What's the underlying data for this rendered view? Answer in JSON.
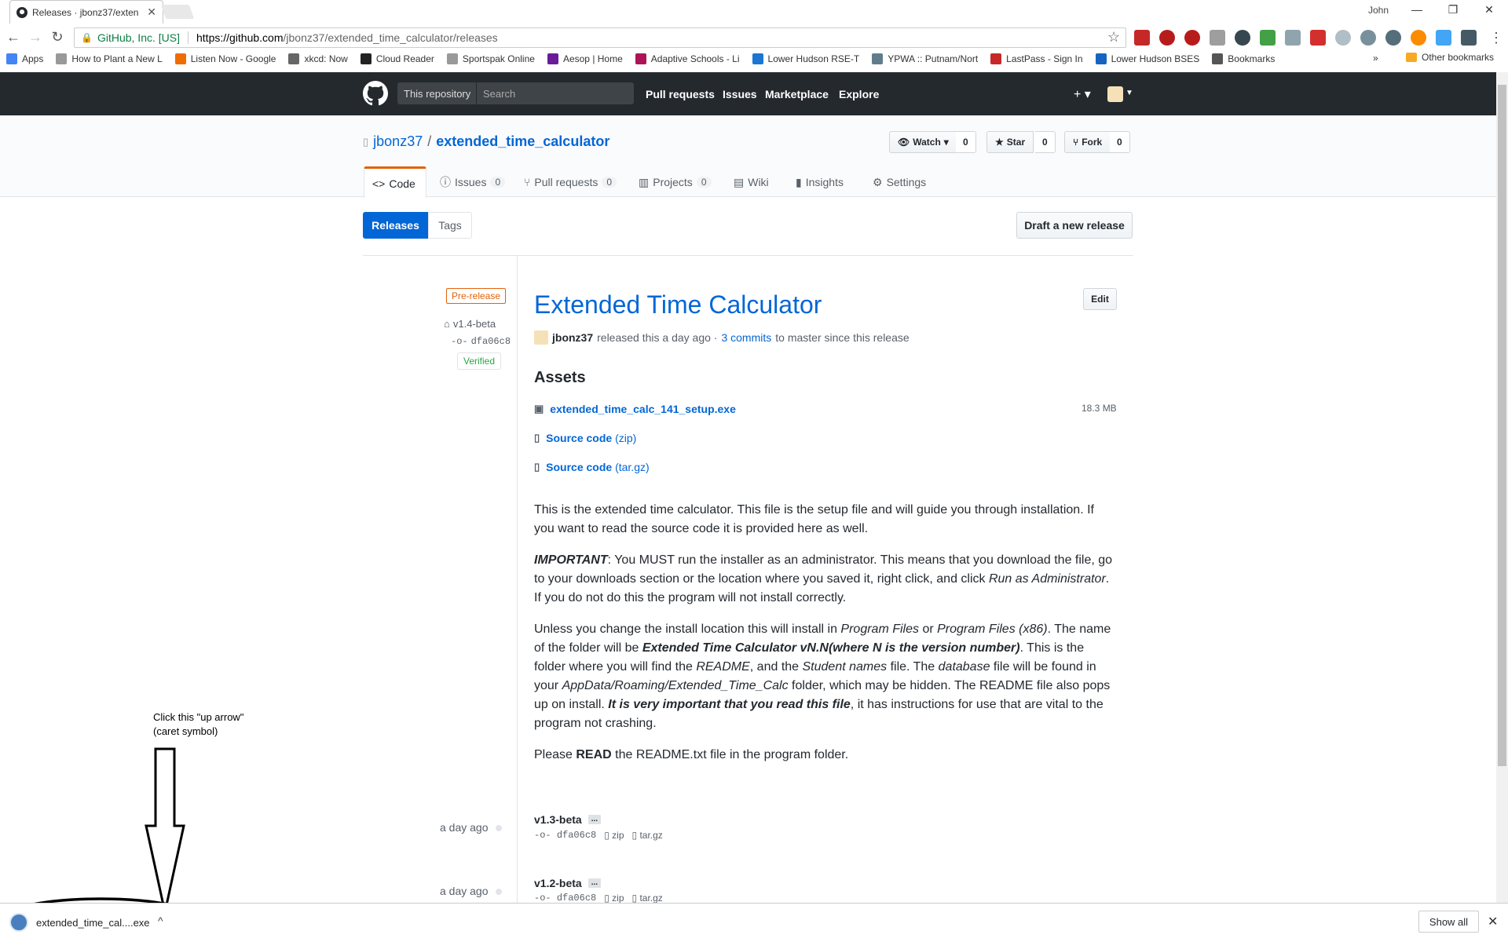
{
  "browser": {
    "tab_title": "Releases · jbonz37/exten",
    "user_label": "John",
    "url_secure_label": "GitHub, Inc. [US]",
    "url_host": "https://github.com",
    "url_path": "/jbonz37/extended_time_calculator/releases"
  },
  "bookmarks": [
    {
      "label": "Apps",
      "icon": "apps-grid-icon",
      "color": "#4285f4"
    },
    {
      "label": "How to Plant a New L",
      "icon": "page-icon",
      "color": "#999999"
    },
    {
      "label": "Listen Now - Google",
      "icon": "music-icon",
      "color": "#ef6c00"
    },
    {
      "label": "xkcd: Now",
      "icon": "xkcd-icon",
      "color": "#666666"
    },
    {
      "label": "Cloud Reader",
      "icon": "kindle-icon",
      "color": "#222222"
    },
    {
      "label": "Sportspak Online",
      "icon": "page-icon",
      "color": "#999999"
    },
    {
      "label": "Aesop | Home",
      "icon": "aesop-icon",
      "color": "#6a1b9a"
    },
    {
      "label": "Adaptive Schools - Li",
      "icon": "page-icon",
      "color": "#ad1457"
    },
    {
      "label": "Lower Hudson RSE-T",
      "icon": "vs-icon",
      "color": "#1976d2"
    },
    {
      "label": "YPWA :: Putnam/Nort",
      "icon": "ypwa-icon",
      "color": "#607d8b"
    },
    {
      "label": "LastPass - Sign In",
      "icon": "lastpass-icon",
      "color": "#c62828"
    },
    {
      "label": "Lower Hudson BSES",
      "icon": "frame-icon",
      "color": "#1565c0"
    },
    {
      "label": "Bookmarks",
      "icon": "star-icon",
      "color": "#555555"
    }
  ],
  "other_bookmarks": "Other bookmarks",
  "github": {
    "scope_label": "This repository",
    "search_placeholder": "Search",
    "nav": [
      "Pull requests",
      "Issues",
      "Marketplace",
      "Explore"
    ]
  },
  "repo": {
    "owner": "jbonz37",
    "separator": "/",
    "name": "extended_time_calculator",
    "watch_label": "Watch",
    "watch_count": "0",
    "star_label": "Star",
    "star_count": "0",
    "fork_label": "Fork",
    "fork_count": "0",
    "tabs": [
      {
        "label": "Code",
        "count": ""
      },
      {
        "label": "Issues",
        "count": "0"
      },
      {
        "label": "Pull requests",
        "count": "0"
      },
      {
        "label": "Projects",
        "count": "0"
      },
      {
        "label": "Wiki",
        "count": ""
      },
      {
        "label": "Insights",
        "count": ""
      },
      {
        "label": "Settings",
        "count": ""
      }
    ]
  },
  "subnav": {
    "releases": "Releases",
    "tags": "Tags",
    "draft": "Draft a new release"
  },
  "release": {
    "prerelease_label": "Pre-release",
    "tag": "v1.4-beta",
    "commit": "dfa06c8",
    "verified": "Verified",
    "title": "Extended Time Calculator",
    "edit_label": "Edit",
    "author": "jbonz37",
    "released_text": "released this a day ago ·",
    "commits_link": "3 commits",
    "commits_suffix": "to master since this release",
    "assets_heading": "Assets",
    "assets": [
      {
        "name": "extended_time_calc_141_setup.exe",
        "sub": "",
        "size": "18.3 MB"
      },
      {
        "name": "Source code",
        "sub": "(zip)",
        "size": ""
      },
      {
        "name": "Source code",
        "sub": "(tar.gz)",
        "size": ""
      }
    ],
    "p1": "This is the extended time calculator. This file is the setup file and will guide you through installation. If you want to read the source code it is provided here as well.",
    "p2_lead": "IMPORTANT",
    "p2_a": ": You MUST run the installer as an administrator. This means that you download the file, go to your downloads section or the location where you saved it, right click, and click ",
    "p2_em": "Run as Administrator",
    "p2_b": ". If you do not do this the program will not install correctly.",
    "p3_a": "Unless you change the install location this will install in ",
    "p3_em1": "Program Files",
    "p3_b": " or ",
    "p3_em2": "Program Files (x86)",
    "p3_c": ". The name of the folder will be ",
    "p3_strong": "Extended Time Calculator vN.N(where N is the version number)",
    "p3_d": ". This is the folder where you will find the ",
    "p3_em3": "README",
    "p3_e": ", and the ",
    "p3_em4": "Student names",
    "p3_f": " file. The ",
    "p3_em5": "database",
    "p3_g": " file will be found in your ",
    "p3_em6": "AppData/Roaming/Extended_Time_Calc",
    "p3_h": " folder, which may be hidden. The README file also pops up on install. ",
    "p3_strong2": "It is very important that you read this file",
    "p3_i": ", it has instructions for use that are vital to the program not crashing.",
    "p4_a": "Please ",
    "p4_strong": "READ",
    "p4_b": " the README.txt file in the program folder."
  },
  "older_releases": [
    {
      "date": "a day ago",
      "tag": "v1.3-beta",
      "dots": "...",
      "commit": "dfa06c8",
      "zip": "zip",
      "targz": "tar.gz"
    },
    {
      "date": "a day ago",
      "tag": "v1.2-beta",
      "dots": "...",
      "commit": "dfa06c8",
      "zip": "zip",
      "targz": "tar.gz"
    }
  ],
  "annotation": {
    "line1": "Click this \"up arrow\"",
    "line2": "(caret symbol)"
  },
  "download_shelf": {
    "filename": "extended_time_cal....exe",
    "caret": "^",
    "show_all": "Show all",
    "close": "✕"
  }
}
